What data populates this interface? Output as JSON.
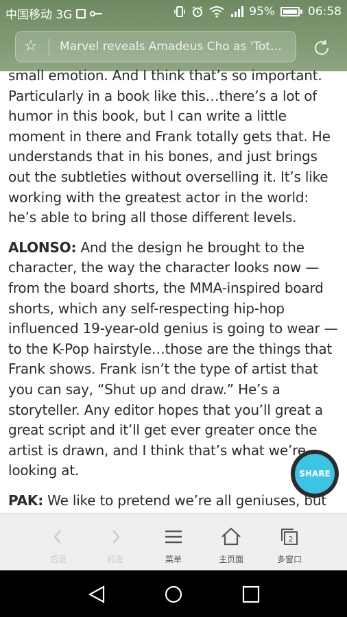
{
  "status_bar": {
    "carrier": "中国移动 3G",
    "battery": "95%",
    "time": "06:58"
  },
  "address_bar": {
    "page_title": "Marvel reveals Amadeus Cho as 'Totally Awesome Hulk'"
  },
  "article": {
    "paragraph_1": "small emotion. And I think that’s so important. Particularly in a book like this…there’s a lot of humor in this book, but I can write a little moment in there and Frank totally gets that. He understands that in his bones, and just brings out the subtleties without overselling it. It’s like working with the greatest actor in the world: he’s able to bring all those different levels.",
    "paragraph_2_speaker": "ALONSO:",
    "paragraph_2": "And the design he brought to the character, the way the character looks now — from the board shorts, the MMA-inspired board shorts, which any self-respecting hip-hop influenced 19-year-old genius is going to wear — to the K-Pop hairstyle…those are the things that Frank shows. Frank isn’t the type of artist that you can say, “Shut up and draw.” He’s a storyteller. Any editor hopes that you’ll great a great script and it’ll get ever greater once the artist is drawn, and I think that’s what we’re looking at.",
    "paragraph_3_speaker": "PAK:",
    "paragraph_3": "We like to pretend we’re all geniuses, but"
  },
  "share_button": {
    "label": "SHARE"
  },
  "toolbar": {
    "back_label": "后退",
    "forward_label": "前进",
    "menu_label": "菜单",
    "home_label": "主页面",
    "windows_label": "多窗口",
    "windows_count": "2"
  },
  "colors": {
    "header_bg": "#7e9870",
    "share_accent": "#3cc4e4",
    "toolbar_bg": "#efefef"
  }
}
